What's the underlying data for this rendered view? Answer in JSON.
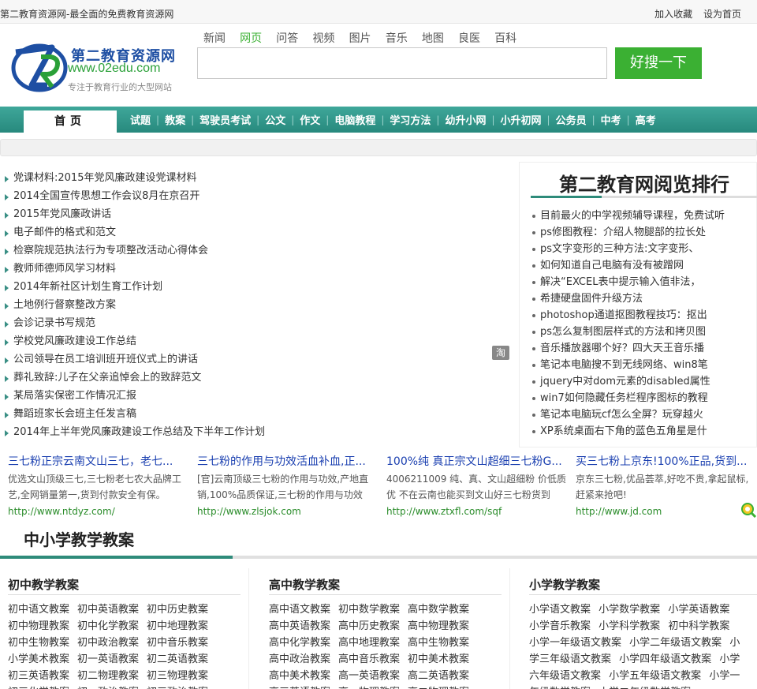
{
  "topbar": {
    "site_title": "第二教育资源网-最全面的免费教育资源网",
    "links": [
      "加入收藏",
      "设为首页"
    ]
  },
  "logo": {
    "name": "第二教育资源网",
    "url": "www.02edu.com",
    "slogan": "专注于教育行业的大型网站",
    "colors": {
      "blue": "#1e4fa3",
      "green": "#2aa038"
    }
  },
  "search": {
    "tabs": [
      "新闻",
      "网页",
      "问答",
      "视频",
      "图片",
      "音乐",
      "地图",
      "良医",
      "百科"
    ],
    "active_tab": "网页",
    "placeholder": "",
    "button_label": "好搜一下",
    "button_color": "#3bb033"
  },
  "nav": {
    "home_label": "首页",
    "items": [
      "试题",
      "教案",
      "驾驶员考试",
      "公文",
      "作文",
      "电脑教程",
      "学习方法",
      "幼升小网",
      "小升初网",
      "公务员",
      "中考",
      "高考"
    ],
    "color": "#2e8b7a"
  },
  "left_list": [
    "党课材料:2015年党风廉政建设党课材料",
    "2014全国宣传思想工作会议8月在京召开",
    "2015年党风廉政讲话",
    "电子邮件的格式和范文",
    "检察院规范执法行为专项整改活动心得体会",
    "教师师德师风学习材料",
    "2014年新社区计划生育工作计划",
    "土地例行督察整改方案",
    "会诊记录书写规范",
    "学校党风廉政建设工作总结",
    "公司领导在员工培训班开班仪式上的讲话",
    "葬礼致辞:儿子在父亲追悼会上的致辞范文",
    "某局落实保密工作情况汇报",
    "舞蹈班家长会班主任发言稿",
    "2014年上半年党风廉政建设工作总结及下半年工作计划"
  ],
  "middle": {
    "tao_icon": "淘"
  },
  "ranking": {
    "title": "第二教育网阅览排行",
    "items": [
      "目前最火的中学视频辅导课程，免费试听",
      "ps修图教程：介绍人物腿部的拉长处",
      "ps文字变形的三种方法:文字变形、",
      "如何知道自己电脑有没有被蹭网",
      "解决“EXCEL表中提示输入值非法，",
      "希捷硬盘固件升级方法",
      "photoshop通道抠图教程技巧：抠出",
      "ps怎么复制图层样式的方法和拷贝图",
      "音乐播放器哪个好？四大天王音乐播",
      "笔记本电脑搜不到无线网络、win8笔",
      "jquery中对dom元素的disabled属性",
      "win7如何隐藏任务栏程序图标的教程",
      "笔记本电脑玩cf怎么全屏？玩穿越火",
      "XP系统桌面右下角的蓝色五角星是什"
    ]
  },
  "ads": [
    {
      "title": "三七粉正宗云南文山三七，老七...",
      "desc": "优选文山顶级三七,三七粉老七农大品牌工艺,全网销量第一,货到付款安全有保。",
      "url": "http://www.ntdyz.com/"
    },
    {
      "title": "三七粉的作用与功效活血补血,正...",
      "desc": "[官]云南顶级三七粉的作用与功效,产地直销,100%品质保证,三七粉的作用与功效",
      "url": "http://www.zlsjok.com"
    },
    {
      "title": "100%纯 真正宗文山超细三七粉G...",
      "desc": "4006211009 纯、真、文山超细粉 价低质优 不在云南也能买到文山好三七粉货到",
      "url": "http://www.ztxfl.com/sqf"
    },
    {
      "title": "买三七粉上京东!100%正品,货到...",
      "desc": "京东三七粉,优品荟萃,好吃不贵,拿起鼠标,赶紧来抢吧!",
      "url": "http://www.jd.com"
    }
  ],
  "section": {
    "title": "中小学教学教案",
    "columns": [
      {
        "title": "初中教学教案",
        "links": [
          "初中语文教案",
          "初中英语教案",
          "初中历史教案",
          "初中物理教案",
          "初中化学教案",
          "初中地理教案",
          "初中生物教案",
          "初中政治教案",
          "初中音乐教案",
          "小学美术教案",
          "初一英语教案",
          "初二英语教案",
          "初三英语教案",
          "初二物理教案",
          "初三物理教案",
          "初三化学教案",
          "初一政治教案",
          "初三政治教案"
        ]
      },
      {
        "title": "高中教学教案",
        "links": [
          "高中语文教案",
          "初中数学教案",
          "高中数学教案",
          "高中英语教案",
          "高中历史教案",
          "高中物理教案",
          "高中化学教案",
          "高中地理教案",
          "高中生物教案",
          "高中政治教案",
          "高中音乐教案",
          "初中美术教案",
          "高中美术教案",
          "高一英语教案",
          "高二英语教案",
          "高三英语教案",
          "高一物理教案",
          "高二物理教案"
        ]
      },
      {
        "title": "小学教学教案",
        "links": [
          "小学语文教案",
          "小学数学教案",
          "小学英语教案",
          "小学音乐教案",
          "小学科学教案",
          "初中科学教案",
          "小学一年级语文教案",
          "小学二年级语文教案",
          "小学三年级语文教案",
          "小学四年级语文教案",
          "小学六年级语文教案",
          "小学五年级语文教案",
          "小学一年级数学教案",
          "小学二年级数学教案"
        ]
      }
    ]
  }
}
